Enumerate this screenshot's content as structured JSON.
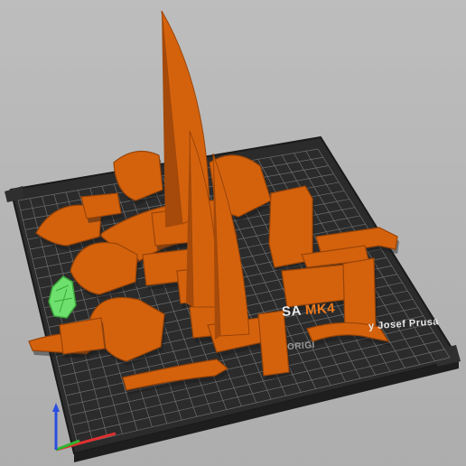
{
  "viewport": {
    "background_color": "#b4b4b4",
    "bed_color": "#2b2b2b",
    "grid_color": "#7e7e7e",
    "part_color": "#d4620d",
    "part_shadow_color": "#9a4408",
    "selected_part_color": "#6ee06e"
  },
  "bed": {
    "brand_prefix": "SA",
    "brand_model": "MK4",
    "brand_author": "y Josef Prusa",
    "brand_original": "ORIGI"
  },
  "axes": {
    "x_color": "#e03030",
    "y_color": "#2fb52f",
    "z_color": "#2a4ee0"
  }
}
